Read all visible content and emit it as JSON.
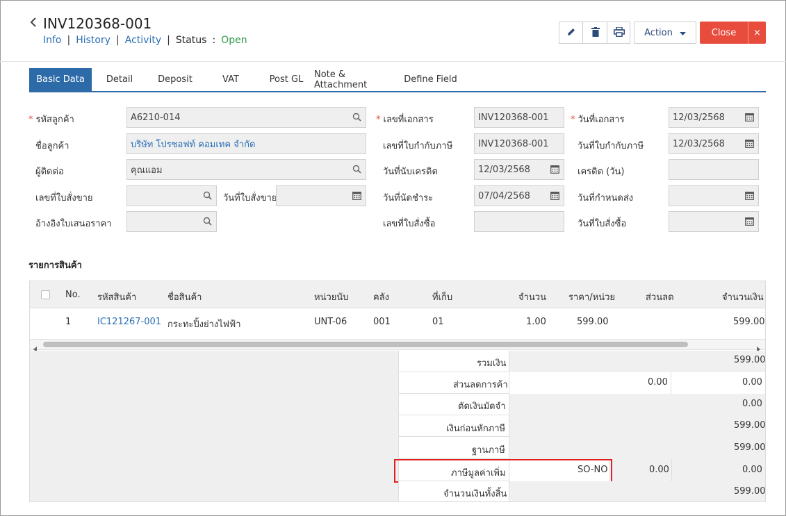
{
  "header": {
    "back_icon": "chevron-left-icon",
    "doc_number": "INV120368-001",
    "nav": {
      "info": "Info",
      "history": "History",
      "activity": "Activity",
      "sep": "|",
      "status_label": "Status",
      "colon": ":",
      "status_value": "Open"
    }
  },
  "toolbar": {
    "edit_icon": "pencil-icon",
    "delete_icon": "trash-icon",
    "print_icon": "printer-icon",
    "action_label": "Action",
    "close_label": "Close",
    "close_x": "×"
  },
  "tabs": [
    "Basic Data",
    "Detail",
    "Deposit",
    "VAT",
    "Post GL",
    "Note & Attachment",
    "Define Field"
  ],
  "form": {
    "customer_code_label": "รหัสลูกค้า",
    "customer_code_value": "A6210-014",
    "customer_name_label": "ชื่อลูกค้า",
    "customer_name_value": "บริษัท โปรซอฟท์ คอมเทค จำกัด",
    "contact_label": "ผู้ติดต่อ",
    "contact_value": "คุณแอม",
    "so_no_label": "เลขที่ใบสั่งขาย",
    "so_date_label": "วันที่ใบสั่งขาย",
    "quote_ref_label": "อ้างอิงใบเสนอราคา",
    "doc_no_label": "เลขที่เอกสาร",
    "doc_no_value": "INV120368-001",
    "tax_inv_no_label": "เลขที่ใบกำกับภาษี",
    "tax_inv_no_value": "INV120368-001",
    "credit_start_label": "วันที่นับเครดิต",
    "credit_start_value": "12/03/2568",
    "due_date_label": "วันที่นัดชำระ",
    "due_date_value": "07/04/2568",
    "po_no_label": "เลขที่ใบสั่งซื้อ",
    "doc_date_label": "วันที่เอกสาร",
    "doc_date_value": "12/03/2568",
    "tax_inv_date_label": "วันที่ใบกำกับภาษี",
    "tax_inv_date_value": "12/03/2568",
    "credit_days_label": "เครดิต (วัน)",
    "delivery_date_label": "วันที่กำหนดส่ง",
    "po_date_label": "วันที่ใบสั่งซื้อ"
  },
  "items": {
    "section_title": "รายการสินค้า",
    "columns": [
      "No.",
      "รหัสสินค้า",
      "ชื่อสินค้า",
      "หน่วยนับ",
      "คลัง",
      "ที่เก็บ",
      "จำนวน",
      "ราคา/หน่วย",
      "ส่วนลด",
      "จำนวนเงิน"
    ],
    "rows": [
      {
        "no": "1",
        "code": "IC121267-001",
        "name": "กระทะปิ้งย่างไฟฟ้า",
        "unit": "UNT-06",
        "warehouse": "001",
        "location": "01",
        "qty": "1.00",
        "price": "599.00",
        "discount": "",
        "amount": "599.00"
      }
    ]
  },
  "summary": {
    "total_label": "รวมเงิน",
    "total_value": "599.00",
    "trade_discount_label": "ส่วนลดการค้า",
    "trade_discount_pct": "0.00",
    "trade_discount_value": "0.00",
    "deposit_label": "ตัดเงินมัดจำ",
    "deposit_value": "0.00",
    "before_tax_label": "เงินก่อนหักภาษี",
    "before_tax_value": "599.00",
    "tax_base_label": "ฐานภาษี",
    "tax_base_value": "599.00",
    "vat_label": "ภาษีมูลค่าเพิ่ม",
    "vat_code": "SO-NO",
    "vat_rate": "0.00",
    "vat_value": "0.00",
    "grand_total_label": "จำนวนเงินทั้งสิ้น",
    "grand_total_value": "599.00"
  },
  "colors": {
    "accent": "#2d6aa8",
    "close": "#e74c3c",
    "highlight": "#e02020",
    "link": "#2a6fb7",
    "status": "#2e9b4b"
  }
}
